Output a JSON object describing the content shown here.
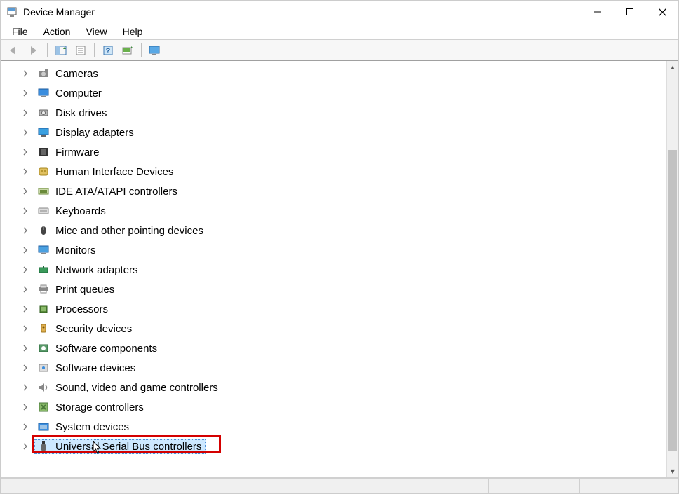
{
  "window": {
    "title": "Device Manager"
  },
  "menu": {
    "file": "File",
    "action": "Action",
    "view": "View",
    "help": "Help"
  },
  "toolbar": {
    "back": "Back",
    "forward": "Forward",
    "show_hide": "Show/Hide Console Tree",
    "properties": "Properties",
    "help": "Help",
    "scan": "Scan for hardware changes",
    "monitor": "Add legacy hardware"
  },
  "tree": {
    "items": [
      {
        "label": "Cameras",
        "icon": "camera"
      },
      {
        "label": "Computer",
        "icon": "computer"
      },
      {
        "label": "Disk drives",
        "icon": "disk"
      },
      {
        "label": "Display adapters",
        "icon": "display"
      },
      {
        "label": "Firmware",
        "icon": "firmware"
      },
      {
        "label": "Human Interface Devices",
        "icon": "hid"
      },
      {
        "label": "IDE ATA/ATAPI controllers",
        "icon": "ide"
      },
      {
        "label": "Keyboards",
        "icon": "keyboard"
      },
      {
        "label": "Mice and other pointing devices",
        "icon": "mouse"
      },
      {
        "label": "Monitors",
        "icon": "monitor"
      },
      {
        "label": "Network adapters",
        "icon": "network"
      },
      {
        "label": "Print queues",
        "icon": "printer"
      },
      {
        "label": "Processors",
        "icon": "cpu"
      },
      {
        "label": "Security devices",
        "icon": "security"
      },
      {
        "label": "Software components",
        "icon": "swcomp"
      },
      {
        "label": "Software devices",
        "icon": "swdev"
      },
      {
        "label": "Sound, video and game controllers",
        "icon": "sound"
      },
      {
        "label": "Storage controllers",
        "icon": "storage"
      },
      {
        "label": "System devices",
        "icon": "system"
      },
      {
        "label": "Universal Serial Bus controllers",
        "icon": "usb",
        "selected": true,
        "highlighted": true
      }
    ]
  }
}
